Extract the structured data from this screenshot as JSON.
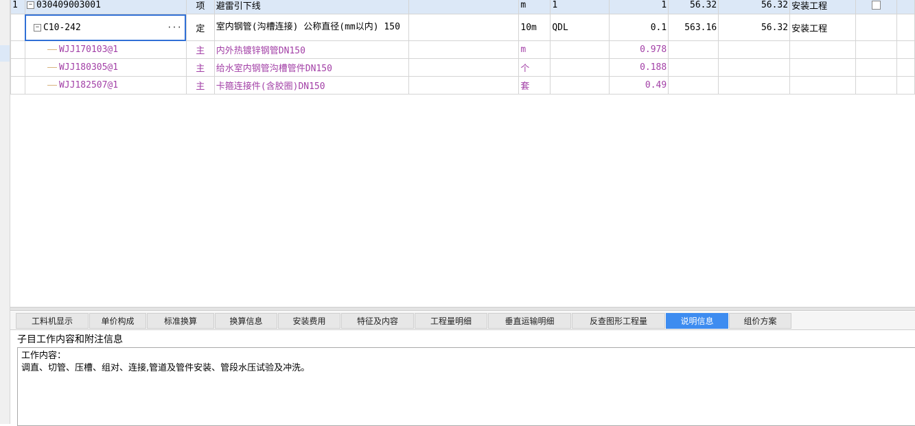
{
  "grid": {
    "rows": [
      {
        "seq": "1",
        "code": "030409003001",
        "type": "项",
        "name": "避雷引下线",
        "spec": "",
        "unit": "m",
        "expr": "1",
        "qty": "1",
        "price": "56.32",
        "total": "56.32",
        "category": "安装工程"
      },
      {
        "seq": "",
        "code": "C10-242",
        "type": "定",
        "name": "室内钢管(沟槽连接) 公称直径(mm以内) 150",
        "spec": "",
        "unit": "10m",
        "expr": "QDL",
        "qty": "0.1",
        "price": "563.16",
        "total": "56.32",
        "category": "安装工程"
      },
      {
        "seq": "",
        "code": "WJJ170103@1",
        "type": "主",
        "name": "内外热镀锌钢管DN150",
        "spec": "",
        "unit": "m",
        "expr": "",
        "qty": "0.978",
        "price": "",
        "total": "",
        "category": ""
      },
      {
        "seq": "",
        "code": "WJJ180305@1",
        "type": "主",
        "name": "给水室内钢管沟槽管件DN150",
        "spec": "",
        "unit": "个",
        "expr": "",
        "qty": "0.188",
        "price": "",
        "total": "",
        "category": ""
      },
      {
        "seq": "",
        "code": "WJJ182507@1",
        "type": "主",
        "name": "卡箍连接件(含胶圈)DN150",
        "spec": "",
        "unit": "套",
        "expr": "",
        "qty": "0.49",
        "price": "",
        "total": "",
        "category": ""
      }
    ],
    "ellipsis": "···",
    "expander": "−"
  },
  "tabs": [
    {
      "label": "工料机显示"
    },
    {
      "label": "单价构成"
    },
    {
      "label": "标准换算"
    },
    {
      "label": "换算信息"
    },
    {
      "label": "安装费用"
    },
    {
      "label": "特征及内容"
    },
    {
      "label": "工程量明细"
    },
    {
      "label": "垂直运输明细"
    },
    {
      "label": "反查图形工程量"
    },
    {
      "label": "说明信息"
    },
    {
      "label": "组价方案"
    }
  ],
  "active_tab": "说明信息",
  "panel": {
    "title": "子目工作内容和附注信息",
    "line1": "工作内容：",
    "line2": "调直、切管、压槽、组对、连接,管道及管件安装、管段水压试验及冲洗。"
  },
  "colors": {
    "accent": "#3d8cf0",
    "selected_row": "#dce8f7",
    "material_text": "#a23fa6"
  }
}
